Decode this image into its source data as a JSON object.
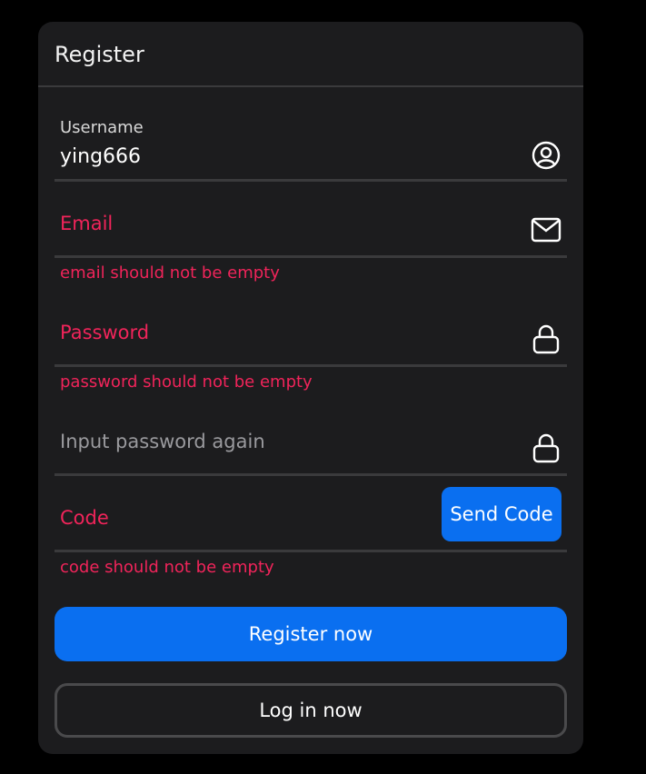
{
  "form": {
    "title": "Register",
    "username": {
      "label": "Username",
      "value": "ying666",
      "icon": "user-circle-icon"
    },
    "email": {
      "placeholder": "Email",
      "error": "email should not be empty",
      "icon": "mail-icon"
    },
    "password": {
      "placeholder": "Password",
      "error": "password should not be empty",
      "icon": "lock-icon"
    },
    "confirm_password": {
      "placeholder": "Input password again",
      "icon": "lock-icon"
    },
    "code": {
      "placeholder": "Code",
      "error": "code should not be empty",
      "send_label": "Send Code"
    },
    "register_label": "Register now",
    "login_label": "Log in now"
  },
  "colors": {
    "background": "#000000",
    "card": "#1c1c1e",
    "primary": "#0a6ff0",
    "error": "#f0245a",
    "divider": "#3a3a3c"
  }
}
